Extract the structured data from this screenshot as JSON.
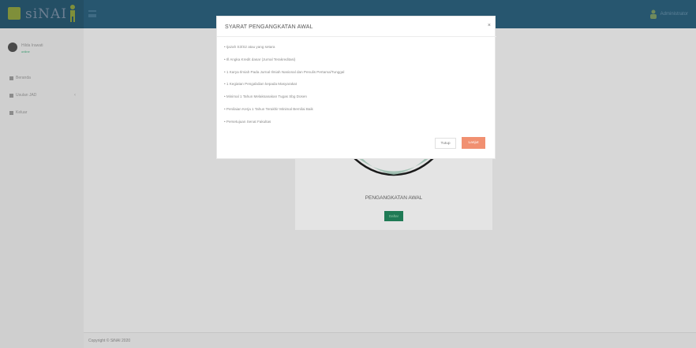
{
  "topbar": {
    "logo_text": "siNAI",
    "user_label": "Administrator"
  },
  "sidebar": {
    "profile": {
      "name": "Hilda Irawati",
      "status": "online"
    },
    "items": [
      {
        "label": "Beranda",
        "icon": "home-icon"
      },
      {
        "label": "Usulan JAD",
        "icon": "grid-icon"
      },
      {
        "label": "Keluar",
        "icon": "logout-icon"
      }
    ]
  },
  "content": {
    "title": "PENGANGKATAN AWAL",
    "button": "Daftar"
  },
  "modal": {
    "title": "SYARAT PENGANGKATAN AWAL",
    "close_icon": "×",
    "requirements": [
      "• Ijazah S3/S2 atau yang setara",
      "• Ill Angka Kredit dasar (Jurnal Terakreditasi)",
      "• 1 Karya Ilmiah Pada Jurnal Ilmiah Nasional dan Penulis Pertama/Tunggal",
      "• 1 Kegiatan Pengabdian kepada Masyarakat",
      "• Minimal 1 Tahun Melaksanakan Tugas Sbg Dosen",
      "• Penilaian Kerja 1 Tahun Terakhir Minimal Bernilai Baik",
      "• Persetujuan Senat Fakultas"
    ],
    "close_button": "Tutup",
    "next_button": "Lanjut"
  },
  "footer": {
    "text": "Copyright © SiNAI 2020"
  },
  "colors": {
    "topbar": "#27566f",
    "accent_green": "#1f7a55",
    "accent_orange": "#f19071"
  }
}
